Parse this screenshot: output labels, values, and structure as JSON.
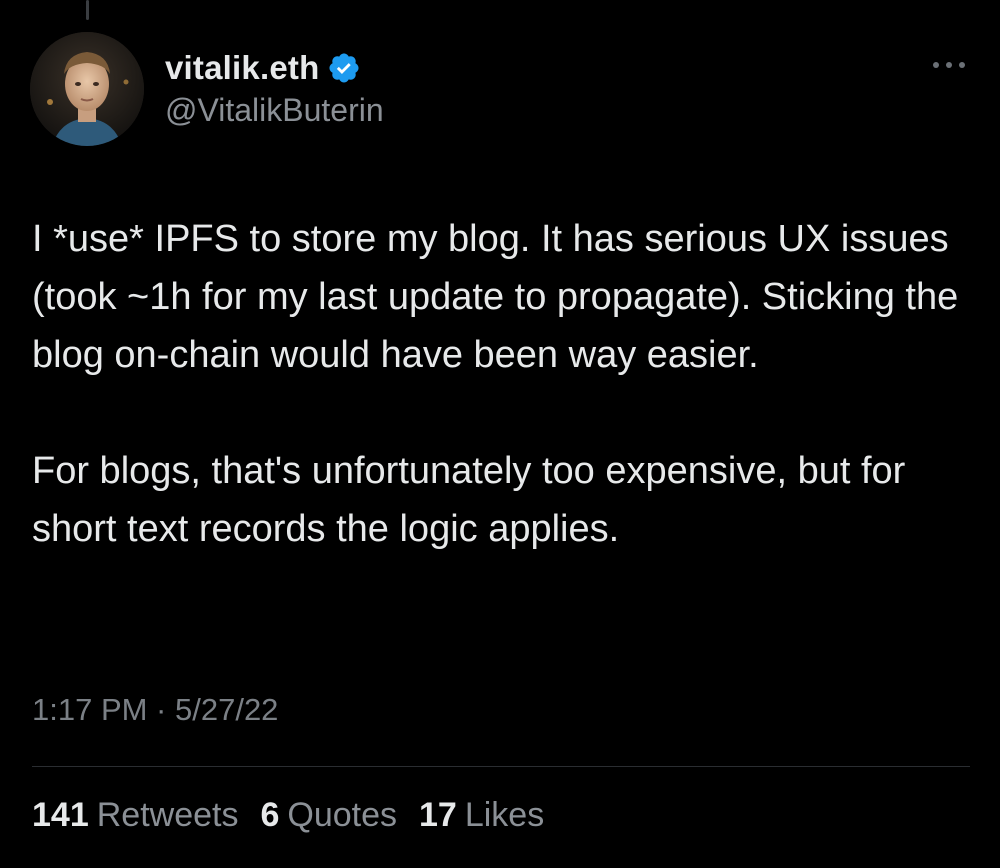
{
  "author": {
    "display_name": "vitalik.eth",
    "handle": "@VitalikButerin",
    "verified_icon": "verified-badge-icon",
    "verified_color": "#1d9bf0"
  },
  "tweet": {
    "paragraphs": [
      "I *use* IPFS to store my blog. It has serious UX issues (took ~1h for my last update to propagate). Sticking the blog on-chain would have been way easier.",
      "For blogs, that's unfortunately too expensive, but for short text records the logic applies."
    ],
    "timestamp": "1:17 PM · 5/27/22"
  },
  "stats": {
    "retweets": {
      "count": "141",
      "label": "Retweets"
    },
    "quotes": {
      "count": "6",
      "label": "Quotes"
    },
    "likes": {
      "count": "17",
      "label": "Likes"
    }
  },
  "menu": {
    "icon": "more-options-icon"
  },
  "colors": {
    "background": "#000000",
    "text_primary": "#e7e9ea",
    "text_secondary": "#8b9096",
    "divider": "#2a2d31"
  }
}
